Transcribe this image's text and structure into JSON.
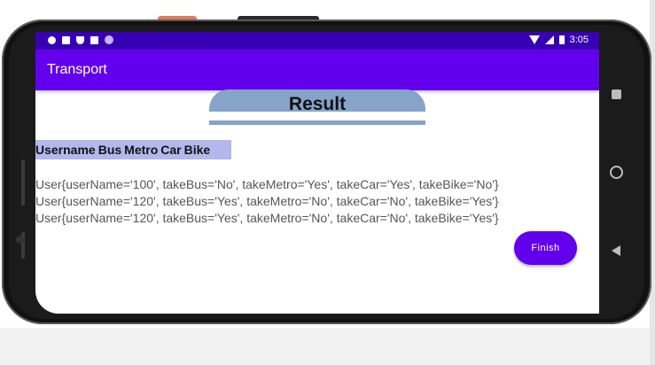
{
  "status_bar": {
    "time": "3:05",
    "left_icons": [
      "gear-icon",
      "a-icon",
      "shield-icon",
      "card-icon",
      "dot-icon"
    ],
    "right_icons": [
      "wifi-icon",
      "signal-icon",
      "battery-icon"
    ]
  },
  "app_bar": {
    "title": "Transport"
  },
  "colors": {
    "status_bar": "#3700b3",
    "app_bar": "#6200ee",
    "result_pill": "#85a4c7",
    "header_highlight": "#b3b8ec",
    "finish_button": "#6200ee"
  },
  "main": {
    "result_label": "Result",
    "headers": [
      "Username",
      "Bus",
      "Metro",
      "Car",
      "Bike"
    ],
    "rows": [
      "User{userName='100', takeBus='No', takeMetro='Yes', takeCar='Yes', takeBike='No'}",
      "User{userName='120', takeBus='Yes', takeMetro='No', takeCar='No', takeBike='Yes'}",
      "User{userName='120', takeBus='Yes', takeMetro='No', takeCar='No', takeBike='Yes'}"
    ],
    "finish_label": "Finish"
  }
}
